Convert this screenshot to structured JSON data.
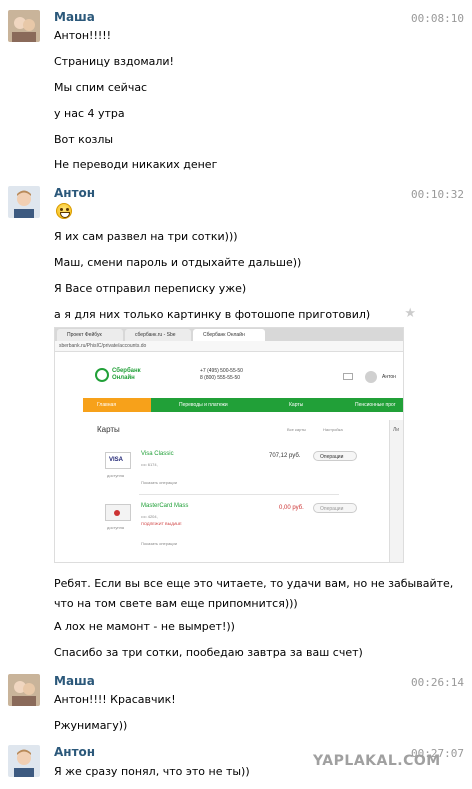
{
  "messages": [
    {
      "author": "Маша",
      "time": "00:08:10",
      "lines": [
        "Антон!!!!!",
        "Страницу вздомали!",
        "Мы спим сейчас",
        "у нас 4 утра",
        "Вот козлы",
        "Не переводи никаких денег"
      ]
    },
    {
      "author": "Антон",
      "time": "00:10:32",
      "emoji": "smile-emoji",
      "lines": [
        "Я их сам развел на три сотки)))",
        "Маш, смени пароль и отдыхайте дальше))",
        "Я Васе отправил переписку уже)",
        "а я для них только картинку в фотошопе приготовил)"
      ],
      "after_lines": [
        "Ребят. Если вы все еще это читаете, то удачи вам, но не забывайте, что на том свете вам еще припомнится)))",
        "А лох не мамонт - не вымрет!))",
        "Спасибо за три сотки, пообедаю завтра за ваш счет)"
      ]
    },
    {
      "author": "Маша",
      "time": "00:26:14",
      "lines": [
        "Антон!!!! Красавчик!",
        "Ржунимагу))"
      ]
    },
    {
      "author": "Антон",
      "time": "00:27:07",
      "lines": [
        "Я же сразу понял, что это не ты))"
      ]
    }
  ],
  "embedded_screenshot": {
    "browser_tabs": [
      "Проект Фейбук",
      "сбербанк.ru - Sbe",
      "Сбербанк Онлайн"
    ],
    "address": "sberbank.ru/PhisIC/private/accounts.do",
    "logo_line1": "Сбербанк",
    "logo_line2": "Онлайн",
    "phone1": "+7 (495) 500-55-50",
    "phone2": "8 (800) 555-55-50",
    "user": "Антон",
    "nav": [
      "Главная",
      "Переводы и платежи",
      "Карты",
      "Пенсионные прог"
    ],
    "cards_title": "Карты",
    "all_cards": "Все карты",
    "settings": "Настройка",
    "card1": {
      "name": "Visa Classic",
      "number": "•••• 6174,",
      "amount": "707,12 руб.",
      "action": "Операции",
      "status": "доступна",
      "link": "Показать операции",
      "brand": "VISA"
    },
    "card2": {
      "name": "MasterCard Mass",
      "number": "•••• 4204,",
      "amount": "0,00 руб.",
      "action": "Операции",
      "status": "доступна",
      "note": "ПОДЛЕЖИТ ВЫДАЧЕ",
      "link": "Показать операции"
    },
    "side_label": "Ли"
  },
  "watermark": "YAPLAKAL.COM",
  "colors": {
    "author": "#2b587a",
    "time": "#999999",
    "sber_green": "#21a038",
    "nav_orange": "#f7a11a"
  }
}
